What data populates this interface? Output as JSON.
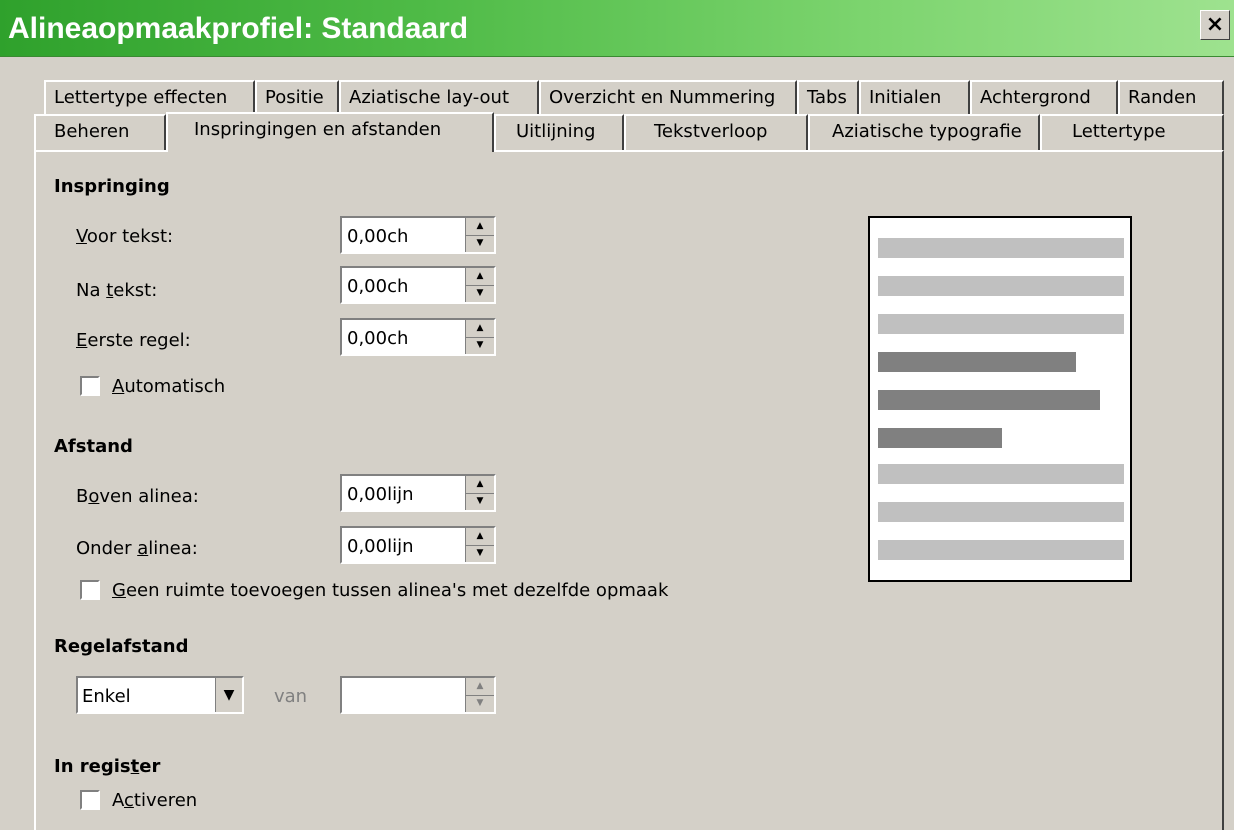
{
  "window": {
    "title": "Alineaopmaakprofiel: Standaard",
    "close_label": "×"
  },
  "tabs_row1": [
    {
      "label": "Lettertype effecten"
    },
    {
      "label": "Positie"
    },
    {
      "label": "Aziatische lay-out"
    },
    {
      "label": "Overzicht en Nummering"
    },
    {
      "label": "Tabs"
    },
    {
      "label": "Initialen"
    },
    {
      "label": "Achtergrond"
    },
    {
      "label": "Randen"
    }
  ],
  "tabs_row2": [
    {
      "label": "Beheren"
    },
    {
      "label": "Inspringingen en afstanden",
      "selected": true
    },
    {
      "label": "Uitlijning"
    },
    {
      "label": "Tekstverloop"
    },
    {
      "label": "Aziatische typografie"
    },
    {
      "label": "Lettertype"
    }
  ],
  "inspringing": {
    "heading": "Inspringing",
    "voor_tekst": {
      "label_pre": "",
      "label_u": "V",
      "label_post": "oor tekst:",
      "value": "0,00ch"
    },
    "na_tekst": {
      "label_pre": "Na ",
      "label_u": "t",
      "label_post": "ekst:",
      "value": "0,00ch"
    },
    "eerste_regel": {
      "label_pre": "",
      "label_u": "E",
      "label_post": "erste regel:",
      "value": "0,00ch"
    },
    "automatisch": {
      "label_pre": "",
      "label_u": "A",
      "label_post": "utomatisch",
      "checked": false
    }
  },
  "afstand": {
    "heading": "Afstand",
    "boven": {
      "label_pre": "B",
      "label_u": "o",
      "label_post": "ven alinea:",
      "value": "0,00lijn"
    },
    "onder": {
      "label_pre": "Onder ",
      "label_u": "a",
      "label_post": "linea:",
      "value": "0,00lijn"
    },
    "geen_ruimte": {
      "label_pre": "",
      "label_u": "G",
      "label_post": "een ruimte toevoegen tussen alinea's met dezelfde opmaak",
      "checked": false
    }
  },
  "regelafstand": {
    "heading": "Regelafstand",
    "select_value": "Enkel",
    "van_label": "van",
    "van_value": ""
  },
  "in_register": {
    "heading_pre": "In regis",
    "heading_u": "t",
    "heading_post": "er",
    "activeren": {
      "label_pre": "A",
      "label_u": "c",
      "label_post": "tiveren",
      "checked": false
    }
  },
  "colors": {
    "title_gradient_start": "#2fa12c",
    "title_gradient_end": "#9ee28f",
    "preview_light": "#c0c0c0",
    "preview_dark": "#808080",
    "dialog_bg": "#d4d0c8"
  }
}
